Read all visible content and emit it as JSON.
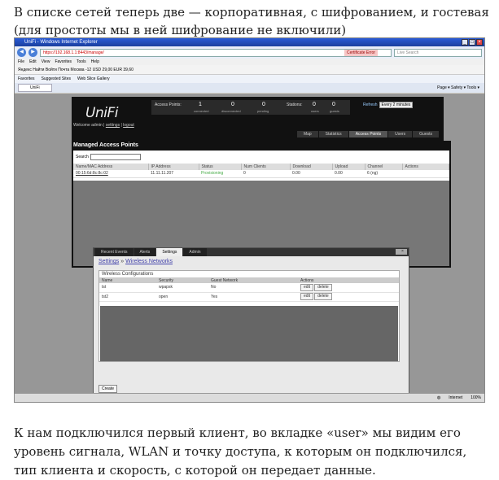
{
  "article": {
    "text_top": "В списке сетей теперь две — корпоративная, с шифрованием, и гостевая (для простоты мы в ней шифрование не включили)",
    "text_bottom": "К нам подключился первый клиент, во вкладке «user» мы видим его уровень сигнала, WLAN и точку доступа, к которым он подключился, тип клиента и скорость, с которой он передает данные."
  },
  "browser": {
    "window_title": "UniFi - Windows Internet Explorer",
    "address": "https://192.168.1.1:8443/manage/",
    "cert_error": "Certificate Error",
    "search_placeholder": "Live Search",
    "menu": [
      "File",
      "Edit",
      "View",
      "Favorites",
      "Tools",
      "Help"
    ],
    "toolbar_text": "Яндекс  Найти  Войти  Почта  Москва -12  USD 29,00  EUR 39,60",
    "favorites_label": "Favorites",
    "fav_items": [
      "Suggested Sites",
      "Web Slice Gallery"
    ],
    "tab_label": "UniFi",
    "tools_text": "Page ▾  Safety ▾  Tools ▾",
    "status_zone": "Internet",
    "zoom": "100%"
  },
  "unifi": {
    "logo": "UniFi",
    "welcome": "Welcome admin",
    "settings_link": "settings",
    "logout_link": "logout",
    "stats": {
      "ap_label": "Access Points:",
      "connected": "1",
      "connected_label": "connected",
      "disconnected": "0",
      "disconnected_label": "disconnected",
      "pending": "0",
      "pending_label": "pending",
      "stations_label": "Stations:",
      "users": "0",
      "users_label": "users",
      "guests": "0",
      "guests_label": "guests"
    },
    "refresh_label": "Refresh",
    "refresh_value": "Every 2 minutes",
    "nav_tabs": [
      "Map",
      "Statistics",
      "Access Points",
      "Users",
      "Guests"
    ],
    "panel_title": "Managed Access Points",
    "search_label": "Search",
    "ap_columns": [
      "Name/MAC Address",
      "IP Address",
      "Status",
      "Num Clients",
      "Download",
      "Upload",
      "Channel",
      "Actions"
    ],
    "ap_rows": [
      [
        "00:15:6d:8c:8c:02",
        "11.11.11.207",
        "Provisioning",
        "0",
        "0.00",
        "0.00",
        "6 (ng)",
        ""
      ]
    ]
  },
  "settings": {
    "tabs": [
      "Recent Events",
      "Alerts",
      "Settings",
      "Admin"
    ],
    "crumb_root": "Settings",
    "crumb_sep": " » ",
    "crumb_leaf": "Wireless Networks",
    "wc_title": "Wireless Configurations",
    "columns": [
      "Name",
      "Security",
      "Guest Network",
      "Actions"
    ],
    "rows": [
      {
        "name": "tst",
        "security": "wpapsk",
        "guest": "No"
      },
      {
        "name": "tst2",
        "security": "open",
        "guest": "Yes"
      }
    ],
    "edit_label": "edit",
    "delete_label": "delete",
    "create_label": "Create"
  }
}
